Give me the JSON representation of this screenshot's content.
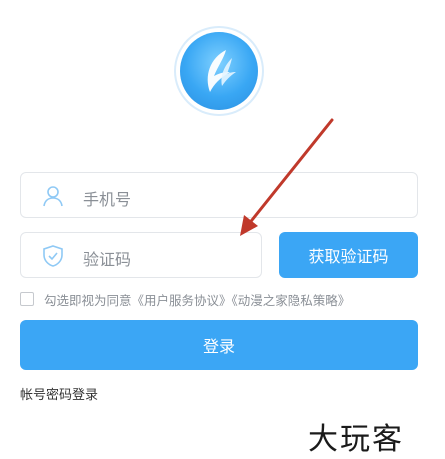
{
  "login_form": {
    "phone_placeholder": "手机号",
    "code_placeholder": "验证码",
    "get_code_label": "获取验证码",
    "agreement_text": "勾选即视为同意《用户服务协议》《动漫之家隐私策略》",
    "login_label": "登录",
    "password_login_label": "帐号密码登录"
  },
  "watermark": "大玩客",
  "icons": {
    "logo": "wing-logo-icon",
    "phone": "user-icon",
    "code": "shield-check-icon"
  },
  "colors": {
    "accent": "#3ba6f5",
    "annotation_arrow": "#c0392b"
  }
}
